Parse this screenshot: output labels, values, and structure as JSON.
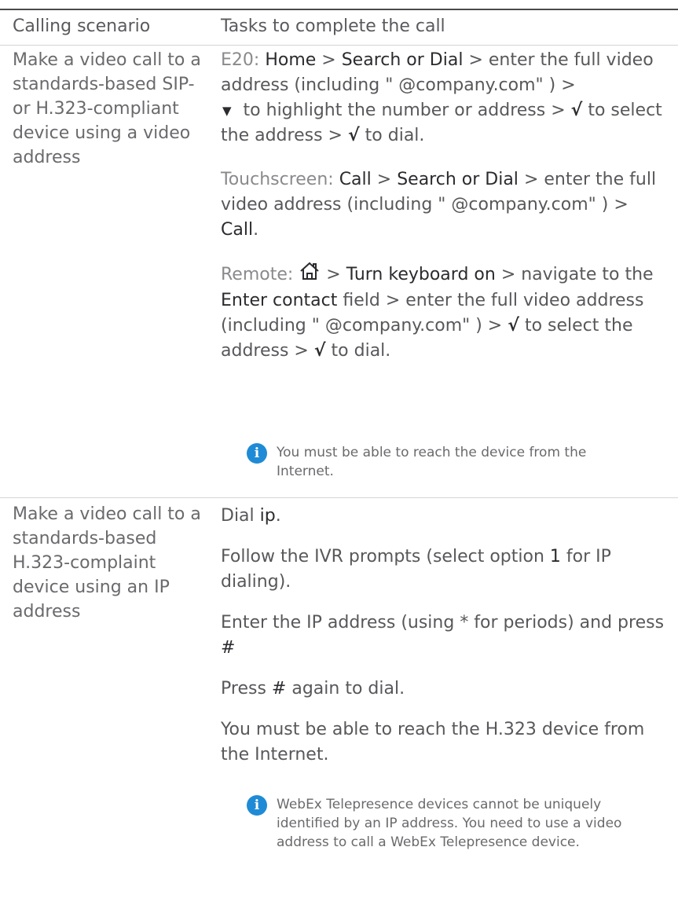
{
  "table": {
    "header": {
      "scenario": "Calling scenario",
      "tasks": "Tasks to complete the call"
    },
    "rows": [
      {
        "scenario": "Make a video call to a standards-based SIP- or H.323-compliant device using a video address",
        "e20": {
          "label": "E20:",
          "home": "Home",
          "sep1": ">",
          "search": "Search or Dial",
          "text1": "> enter the full video address (including \" @company.com\" ) >",
          "down_arrow": "▼",
          "text2": "to highlight the number or address >",
          "check1": "√",
          "text3": "to select the address >",
          "check2": "√",
          "text4": "to dial."
        },
        "touchscreen": {
          "label": "Touchscreen:",
          "call1": "Call",
          "sep1": ">",
          "search": "Search or Dial",
          "text1": "> enter the full video address (including \" @company.com\" ) >",
          "call2": "Call",
          "end": "."
        },
        "remote": {
          "label": "Remote:",
          "home_icon": "home-icon",
          "sep1": ">",
          "turn_kb": "Turn keyboard on",
          "text1": "> navigate to the",
          "enter_contact": "Enter contact",
          "text2": "field > enter the full video address (including \" @company.com\" ) >",
          "check1": "√",
          "text3": "to select the address >",
          "check2": "√",
          "text4": "to dial."
        },
        "note": "You must be able to reach the device from the Internet."
      },
      {
        "scenario": "Make a video call to a standards-based H.323-complaint device using an IP address",
        "steps": {
          "dial_pre": "Dial",
          "dial_ip": "ip",
          "dial_end": ".",
          "ivr_pre": "Follow the IVR prompts (select option",
          "ivr_num": "1",
          "ivr_post": "for IP dialing).",
          "enter_pre": "Enter the IP address (using * for periods) and press",
          "enter_key": "#",
          "press_pre": "Press",
          "press_key": "#",
          "press_post": "again to dial.",
          "reach": "You must be able to reach the H.323 device from the Internet."
        },
        "note": "WebEx Telepresence devices cannot be uniquely identified by an IP address. You need to use a video address to call a WebEx Telepresence device."
      }
    ]
  },
  "colors": {
    "info_icon": "#1f8bd6",
    "text": "#58585b",
    "label": "#8a8a8d",
    "ui_term": "#2b2b2f",
    "rule": "#d4d4d4"
  }
}
